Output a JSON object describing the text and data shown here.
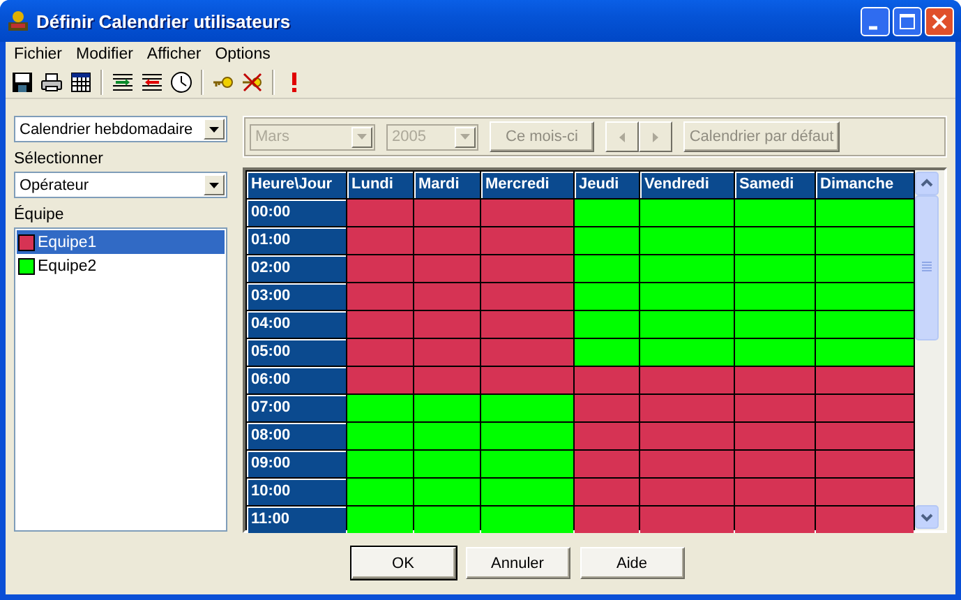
{
  "window": {
    "title": "Définir Calendrier utilisateurs"
  },
  "menu": [
    "Fichier",
    "Modifier",
    "Afficher",
    "Options"
  ],
  "left": {
    "calendar_type": "Calendrier hebdomadaire",
    "select_label": "Sélectionner",
    "select_value": "Opérateur",
    "team_label": "Équipe",
    "teams": [
      {
        "name": "Equipe1",
        "color": "#d63354",
        "selected": true
      },
      {
        "name": "Equipe2",
        "color": "#00ff00",
        "selected": false
      }
    ]
  },
  "filters": {
    "month": "Mars",
    "year": "2005",
    "disabled": true,
    "today_button": "Ce mois-ci",
    "default_button": "Calendrier par défaut"
  },
  "schedule": {
    "columns": [
      "Heure\\Jour",
      "Lundi",
      "Mardi",
      "Mercredi",
      "Jeudi",
      "Vendredi",
      "Samedi",
      "Dimanche"
    ],
    "rows": [
      {
        "hour": "00:00",
        "cells": [
          {
            "color": "#d63354"
          },
          {
            "color": "#d63354"
          },
          {
            "color": "#d63354"
          },
          {
            "color": "#00ff00"
          },
          {
            "color": "#00ff00"
          },
          {
            "color": "#00ff00"
          },
          {
            "color": "#00ff00"
          }
        ]
      },
      {
        "hour": "01:00",
        "cells": [
          {
            "color": "#d63354"
          },
          {
            "color": "#d63354"
          },
          {
            "color": "#d63354"
          },
          {
            "color": "#00ff00"
          },
          {
            "color": "#00ff00"
          },
          {
            "color": "#00ff00"
          },
          {
            "color": "#00ff00"
          }
        ]
      },
      {
        "hour": "02:00",
        "cells": [
          {
            "color": "#d63354"
          },
          {
            "color": "#d63354"
          },
          {
            "color": "#d63354"
          },
          {
            "color": "#00ff00"
          },
          {
            "color": "#00ff00"
          },
          {
            "color": "#00ff00"
          },
          {
            "color": "#00ff00"
          }
        ]
      },
      {
        "hour": "03:00",
        "cells": [
          {
            "color": "#d63354"
          },
          {
            "color": "#d63354"
          },
          {
            "color": "#d63354"
          },
          {
            "color": "#00ff00"
          },
          {
            "color": "#00ff00"
          },
          {
            "color": "#00ff00"
          },
          {
            "color": "#00ff00"
          }
        ]
      },
      {
        "hour": "04:00",
        "cells": [
          {
            "color": "#d63354"
          },
          {
            "color": "#d63354"
          },
          {
            "color": "#d63354"
          },
          {
            "color": "#00ff00"
          },
          {
            "color": "#00ff00"
          },
          {
            "color": "#00ff00"
          },
          {
            "color": "#00ff00"
          }
        ]
      },
      {
        "hour": "05:00",
        "cells": [
          {
            "color": "#d63354"
          },
          {
            "color": "#d63354"
          },
          {
            "color": "#d63354"
          },
          {
            "color": "#00ff00"
          },
          {
            "color": "#00ff00"
          },
          {
            "color": "#00ff00"
          },
          {
            "color": "#00ff00"
          }
        ]
      },
      {
        "hour": "06:00",
        "cells": [
          {
            "color": "#d63354"
          },
          {
            "color": "#d63354"
          },
          {
            "color": "#d63354"
          },
          {
            "color": "#d63354"
          },
          {
            "color": "#d63354"
          },
          {
            "color": "#d63354"
          },
          {
            "color": "#d63354"
          }
        ]
      },
      {
        "hour": "07:00",
        "cells": [
          {
            "color": "#00ff00"
          },
          {
            "color": "#00ff00"
          },
          {
            "color": "#00ff00"
          },
          {
            "color": "#d63354"
          },
          {
            "color": "#d63354"
          },
          {
            "color": "#d63354"
          },
          {
            "color": "#d63354"
          }
        ]
      },
      {
        "hour": "08:00",
        "cells": [
          {
            "color": "#00ff00"
          },
          {
            "color": "#00ff00"
          },
          {
            "color": "#00ff00"
          },
          {
            "color": "#d63354"
          },
          {
            "color": "#d63354"
          },
          {
            "color": "#d63354"
          },
          {
            "color": "#d63354"
          }
        ]
      },
      {
        "hour": "09:00",
        "cells": [
          {
            "color": "#00ff00"
          },
          {
            "color": "#00ff00"
          },
          {
            "color": "#00ff00"
          },
          {
            "color": "#d63354"
          },
          {
            "color": "#d63354"
          },
          {
            "color": "#d63354"
          },
          {
            "color": "#d63354"
          }
        ]
      },
      {
        "hour": "10:00",
        "cells": [
          {
            "color": "#00ff00"
          },
          {
            "color": "#00ff00"
          },
          {
            "color": "#00ff00"
          },
          {
            "color": "#d63354"
          },
          {
            "color": "#d63354"
          },
          {
            "color": "#d63354"
          },
          {
            "color": "#d63354"
          }
        ]
      },
      {
        "hour": "11:00",
        "cells": [
          {
            "color": "#00ff00"
          },
          {
            "color": "#00ff00"
          },
          {
            "color": "#00ff00"
          },
          {
            "color": "#d63354"
          },
          {
            "color": "#d63354"
          },
          {
            "color": "#d63354"
          },
          {
            "color": "#d63354"
          }
        ]
      }
    ]
  },
  "buttons": [
    {
      "label": "OK",
      "default": true
    },
    {
      "label": "Annuler",
      "default": false
    },
    {
      "label": "Aide",
      "default": false
    }
  ]
}
